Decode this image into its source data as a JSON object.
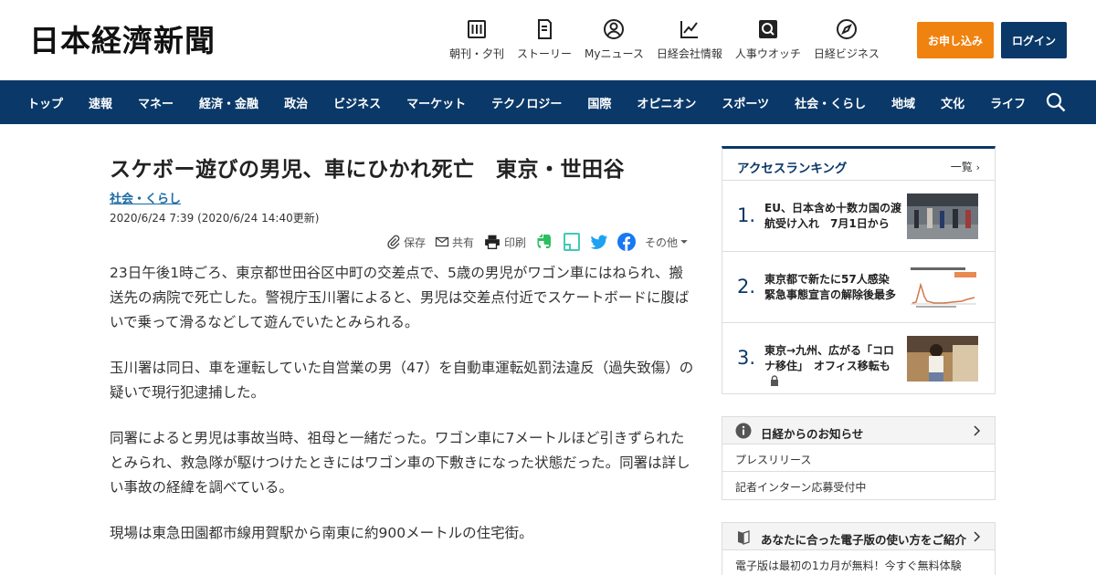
{
  "header": {
    "logo": "日本経濟新聞",
    "topnav": [
      {
        "label": "朝刊・夕刊",
        "icon": "newspaper-icon"
      },
      {
        "label": "ストーリー",
        "icon": "book-icon"
      },
      {
        "label": "Myニュース",
        "icon": "person-icon"
      },
      {
        "label": "日経会社情報",
        "icon": "chart-icon"
      },
      {
        "label": "人事ウオッチ",
        "icon": "magnifier-icon"
      },
      {
        "label": "日経ビジネス",
        "icon": "compass-icon"
      }
    ],
    "subscribe_label": "お申し込み",
    "login_label": "ログイン"
  },
  "nav": {
    "items": [
      "トップ",
      "速報",
      "マネー",
      "経済・金融",
      "政治",
      "ビジネス",
      "マーケット",
      "テクノロジー",
      "国際",
      "オピニオン",
      "スポーツ",
      "社会・くらし",
      "地域",
      "文化",
      "ライフ"
    ]
  },
  "article": {
    "title": "スケボー遊びの男児、車にひかれ死亡　東京・世田谷",
    "category": "社会・くらし",
    "date": "2020/6/24 7:39 (2020/6/24 14:40更新)",
    "tools": {
      "save": "保存",
      "share": "共有",
      "print": "印刷",
      "more": "その他"
    },
    "paragraphs": [
      "23日午後1時ごろ、東京都世田谷区中町の交差点で、5歳の男児がワゴン車にはねられ、搬送先の病院で死亡した。警視庁玉川署によると、男児は交差点付近でスケートボードに腹ばいで乗って滑るなどして遊んでいたとみられる。",
      "玉川署は同日、車を運転していた自営業の男（47）を自動車運転処罰法違反（過失致傷）の疑いで現行犯逮捕した。",
      "同署によると男児は事故当時、祖母と一緒だった。ワゴン車に7メートルほど引きずられたとみられ、救急隊が駆けつけたときにはワゴン車の下敷きになった状態だった。同署は詳しい事故の経緯を調べている。",
      "現場は東急田園都市線用賀駅から南東に約900メートルの住宅街。"
    ]
  },
  "sidebar": {
    "ranking": {
      "title": "アクセスランキング",
      "more": "一覧",
      "items": [
        {
          "rank": "1.",
          "text": "EU、日本含め十数カ国の渡航受け入れ　7月1日から"
        },
        {
          "rank": "2.",
          "text": "東京都で新たに57人感染　緊急事態宣言の解除後最多"
        },
        {
          "rank": "3.",
          "text": "東京→九州、広がる「コロナ移住」　オフィス移転も"
        }
      ]
    },
    "notice": {
      "title": "日経からのお知らせ",
      "items": [
        "プレスリリース",
        "記者インターン応募受付中"
      ]
    },
    "guide": {
      "title": "あなたに合った電子版の使い方をご紹介",
      "text": "電子版は最初の1カ月が無料！今すぐ無料体験"
    }
  },
  "colors": {
    "brand": "#0a3868",
    "accent": "#f0820f",
    "link": "#1a6aa3"
  }
}
